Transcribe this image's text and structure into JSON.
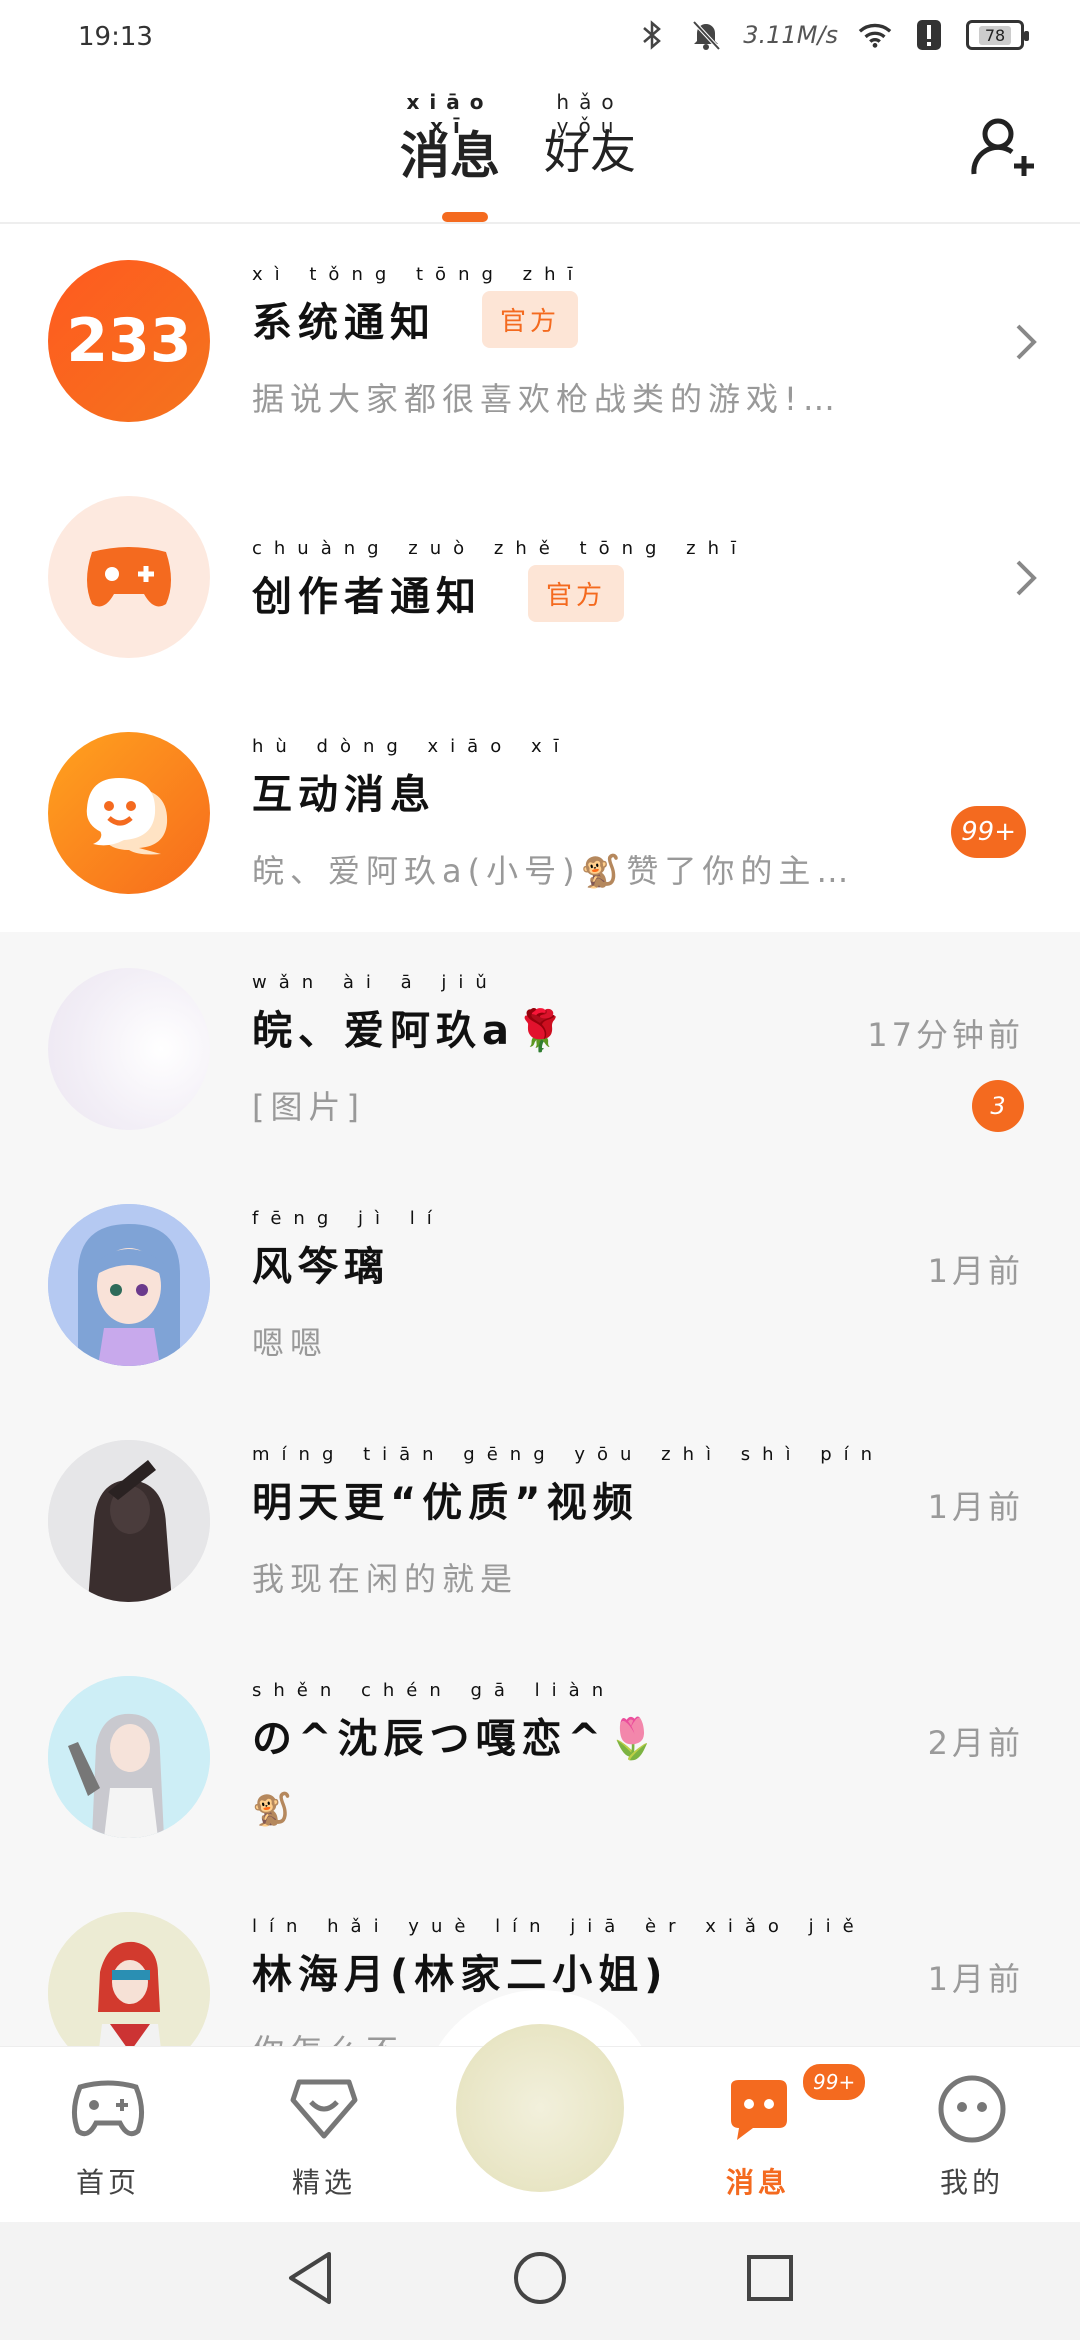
{
  "status_bar": {
    "time": "19:13",
    "net_speed": "3.11M/s",
    "battery": "78"
  },
  "header": {
    "tabs": [
      {
        "label": "消息",
        "pinyin": "xiāo xī",
        "active": true
      },
      {
        "label": "好友",
        "pinyin": "hǎo yǒu",
        "active": false
      }
    ]
  },
  "conversations": [
    {
      "name": "系统通知",
      "pinyin": "xì tǒng tōng zhī",
      "official": "官方",
      "preview": "据说大家都很喜欢枪战类的游戏!…",
      "time": "",
      "count": "",
      "avatar": "app-233-logo",
      "style": "white"
    },
    {
      "name": "创作者通知",
      "pinyin": "chuàng zuò zhě tōng zhī",
      "official": "官方",
      "preview": "",
      "time": "",
      "count": "",
      "avatar": "gamepad-plus",
      "style": "white"
    },
    {
      "name": "互动消息",
      "pinyin": "hù dòng xiāo xī",
      "official": "",
      "preview": "皖、爱阿玖a(小号)🐒赞了你的主…",
      "time": "",
      "count": "99+",
      "avatar": "chat-bubble",
      "style": "white"
    },
    {
      "name": "皖、爱阿玖a🌹",
      "pinyin": "wǎn ài ā jiǔ",
      "official": "",
      "preview": "[图片]",
      "time": "17分钟前",
      "count": "3",
      "avatar": "blank",
      "style": "grey"
    },
    {
      "name": "风笒璃",
      "pinyin": "fēng jì lí",
      "official": "",
      "preview": "嗯嗯",
      "time": "1月前",
      "count": "",
      "avatar": "anime-blue-hair",
      "style": "grey"
    },
    {
      "name": "明天更“优质”视频",
      "pinyin": "míng tiān gēng yōu zhì shì pín",
      "official": "",
      "preview": "我现在闲的就是",
      "time": "1月前",
      "count": "",
      "avatar": "anime-dark",
      "style": "grey"
    },
    {
      "name": "の^沈辰つ嘎恋^🌷",
      "pinyin": "shěn chén gā liàn",
      "official": "",
      "preview": "🐒",
      "time": "2月前",
      "count": "",
      "avatar": "anime-silver",
      "style": "grey"
    },
    {
      "name": "林海月(林家二小姐)",
      "pinyin": "lín hǎi yuè lín jiā èr xiǎo jiě",
      "official": "",
      "preview": "你怎么不…",
      "time": "1月前",
      "count": "",
      "avatar": "anime-red",
      "style": "grey"
    }
  ],
  "bottom_nav": {
    "items": [
      {
        "label": "首页",
        "icon": "gamepad-icon"
      },
      {
        "label": "精选",
        "icon": "heart-box-icon"
      },
      {
        "label": "消息",
        "icon": "message-icon",
        "badge": "99+",
        "active": true
      },
      {
        "label": "我的",
        "icon": "face-icon"
      }
    ]
  },
  "colors": {
    "accent": "#f46a1f",
    "badge_bg": "#fde5d6"
  }
}
